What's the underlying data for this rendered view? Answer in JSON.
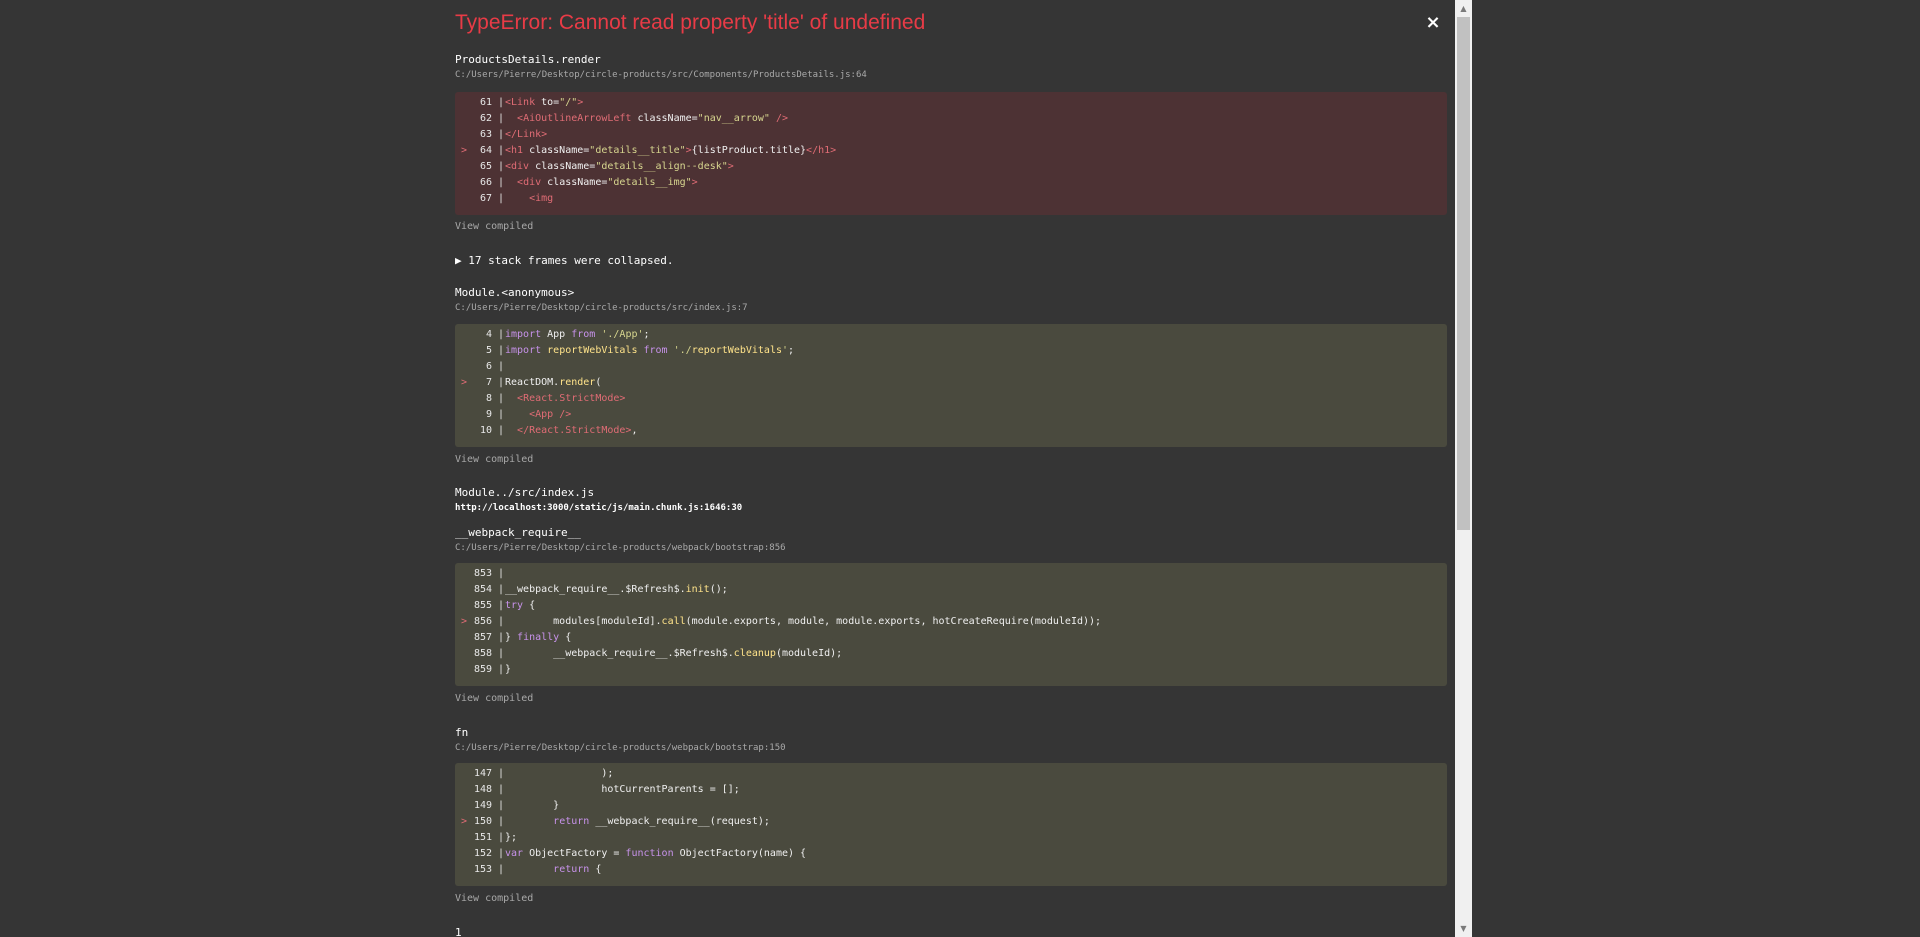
{
  "header": {
    "title": "TypeError: Cannot read property 'title' of undefined",
    "close_label": "×"
  },
  "frames": [
    {
      "function": "ProductsDetails.render",
      "location": "C:/Users/Pierre/Desktop/circle-products/src/Components/ProductsDetails.js:64",
      "lines": [
        "61",
        "62",
        "63",
        "64",
        "65",
        "66",
        "67"
      ],
      "error_line": "64",
      "view_compiled": "View compiled"
    },
    {
      "collapsed_label": "▶ 17 stack frames were collapsed."
    },
    {
      "function": "Module.<anonymous>",
      "location": "C:/Users/Pierre/Desktop/circle-products/src/index.js:7",
      "lines": [
        "4",
        "5",
        "6",
        "7",
        "8",
        "9",
        "10"
      ],
      "error_line": "7",
      "view_compiled": "View compiled"
    },
    {
      "function": "Module../src/index.js",
      "location": "http://localhost:3000/static/js/main.chunk.js:1646:30"
    },
    {
      "function": "__webpack_require__",
      "location": "C:/Users/Pierre/Desktop/circle-products/webpack/bootstrap:856",
      "lines": [
        "853",
        "854",
        "855",
        "856",
        "857",
        "858",
        "859"
      ],
      "error_line": "856",
      "view_compiled": "View compiled"
    },
    {
      "function": "fn",
      "location": "C:/Users/Pierre/Desktop/circle-products/webpack/bootstrap:150",
      "lines": [
        "147",
        "148",
        "149",
        "150",
        "151",
        "152",
        "153"
      ],
      "error_line": "150",
      "view_compiled": "View compiled"
    },
    {
      "function": "1"
    }
  ],
  "code": {
    "f0": [
      "<Link to=\"/\">",
      "  <AiOutlineArrowLeft className=\"nav__arrow\" />",
      "</Link>",
      "<h1 className=\"details__title\">{listProduct.title}</h1>",
      "<div className=\"details__align--desk\">",
      "  <div className=\"details__img\">",
      "    <img"
    ],
    "f2": [
      "import App from './App';",
      "import reportWebVitals from './reportWebVitals';",
      "",
      "ReactDOM.render(",
      "  <React.StrictMode>",
      "    <App />",
      "  </React.StrictMode>,"
    ],
    "f4": [
      "",
      "__webpack_require__.$Refresh$.init();",
      "try {",
      "        modules[moduleId].call(module.exports, module, module.exports, hotCreateRequire(moduleId));",
      "} finally {",
      "        __webpack_require__.$Refresh$.cleanup(moduleId);",
      "}"
    ],
    "f5": [
      "                );",
      "                hotCurrentParents = [];",
      "        }",
      "        return __webpack_require__(request);",
      "};",
      "var ObjectFactory = function ObjectFactory(name) {",
      "        return {"
    ]
  },
  "colors": {
    "error_title": "#e83b46",
    "background": "#353535",
    "error_code_bg": "#4d3234",
    "code_bg": "#4a4a3e"
  },
  "icons": {
    "close": "close-icon",
    "scroll_up": "scroll-up-arrow-icon",
    "scroll_down": "scroll-down-arrow-icon"
  }
}
